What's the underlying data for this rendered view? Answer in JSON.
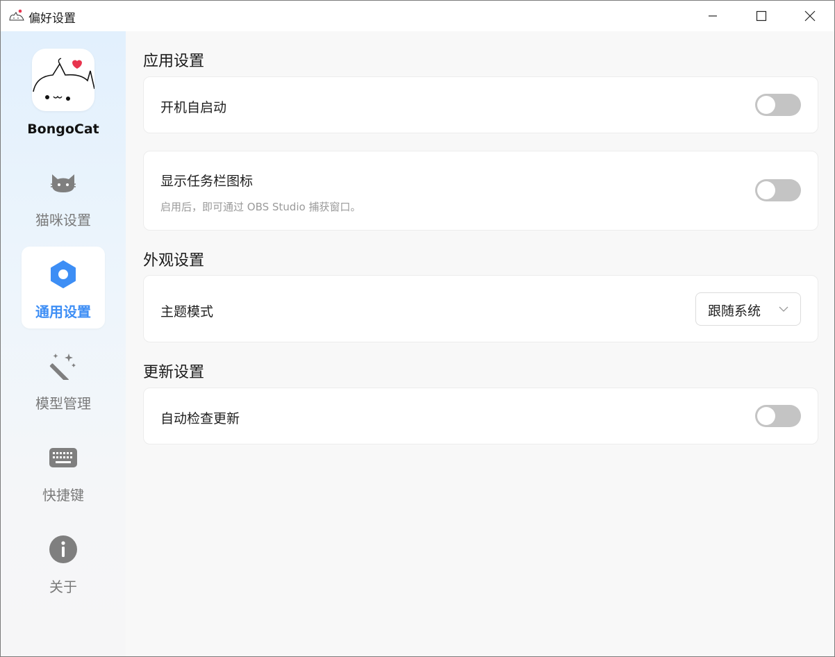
{
  "window": {
    "title": "偏好设置"
  },
  "sidebar": {
    "brand": "BongoCat",
    "items": [
      {
        "label": "猫咪设置",
        "icon": "cat-icon",
        "active": false
      },
      {
        "label": "通用设置",
        "icon": "settings-hexagon-icon",
        "active": true
      },
      {
        "label": "模型管理",
        "icon": "magic-wand-icon",
        "active": false
      },
      {
        "label": "快捷键",
        "icon": "keyboard-icon",
        "active": false
      },
      {
        "label": "关于",
        "icon": "info-icon",
        "active": false
      }
    ]
  },
  "main": {
    "sections": [
      {
        "title": "应用设置",
        "settings": [
          {
            "label": "开机自启动",
            "control": "toggle",
            "value": false
          },
          {
            "label": "显示任务栏图标",
            "description": "启用后，即可通过 OBS Studio 捕获窗口。",
            "control": "toggle",
            "value": false
          }
        ]
      },
      {
        "title": "外观设置",
        "settings": [
          {
            "label": "主题模式",
            "control": "select",
            "value": "跟随系统"
          }
        ]
      },
      {
        "title": "更新设置",
        "settings": [
          {
            "label": "自动检查更新",
            "control": "toggle",
            "value": false
          }
        ]
      }
    ]
  },
  "colors": {
    "accent": "#3d8ef5",
    "toggle_off": "#c4c4c4",
    "heart": "#e8344e"
  }
}
